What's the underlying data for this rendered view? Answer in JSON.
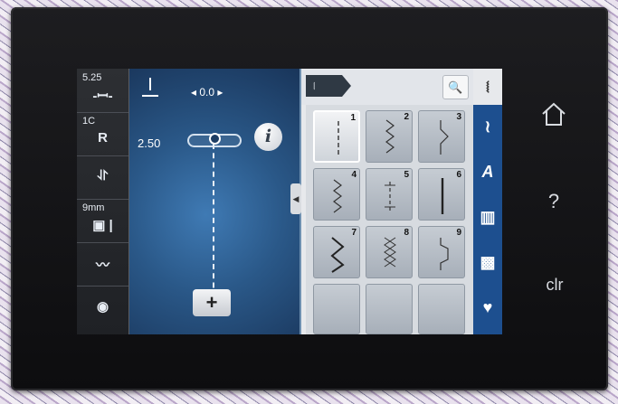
{
  "left_column": [
    {
      "label_top": "5.25",
      "label_main": "-ꟷ-",
      "icon": "thread-tension-icon"
    },
    {
      "label_top": "1C",
      "label_main": "R",
      "icon": "presser-foot-icon"
    },
    {
      "label_top": "",
      "label_main": "⥯",
      "icon": "presser-foot-pressure-icon"
    },
    {
      "label_top": "9mm",
      "label_main": "▣ |",
      "icon": "needle-plate-icon"
    },
    {
      "label_top": "",
      "label_main": "〰",
      "icon": "feed-dog-icon"
    },
    {
      "label_top": "",
      "label_main": "◉",
      "icon": "bobbin-icon"
    }
  ],
  "main": {
    "needle_position": "◂ 0.0 ▸",
    "stitch_width": "2.50",
    "info_label": "i",
    "plus_label": "+"
  },
  "panel": {
    "breadcrumb": "⧙",
    "search_icon": "🔍",
    "stitch_numbers": [
      "1",
      "2",
      "3",
      "4",
      "5",
      "6",
      "7",
      "8",
      "9"
    ],
    "right_tabs": [
      {
        "label": "⧙",
        "icon": "practical-stitches-icon",
        "active": true
      },
      {
        "label": "≀",
        "icon": "decorative-stitches-icon",
        "active": false
      },
      {
        "label": "A",
        "icon": "alphabets-icon",
        "active": false
      },
      {
        "label": "▥",
        "icon": "buttonholes-icon",
        "active": false
      },
      {
        "label": "▩",
        "icon": "quilt-stitches-icon",
        "active": false
      },
      {
        "label": "♥",
        "icon": "personal-program-icon",
        "active": false
      }
    ]
  },
  "hardware": {
    "home": "home-icon",
    "help_label": "?",
    "clear_label": "clr"
  }
}
